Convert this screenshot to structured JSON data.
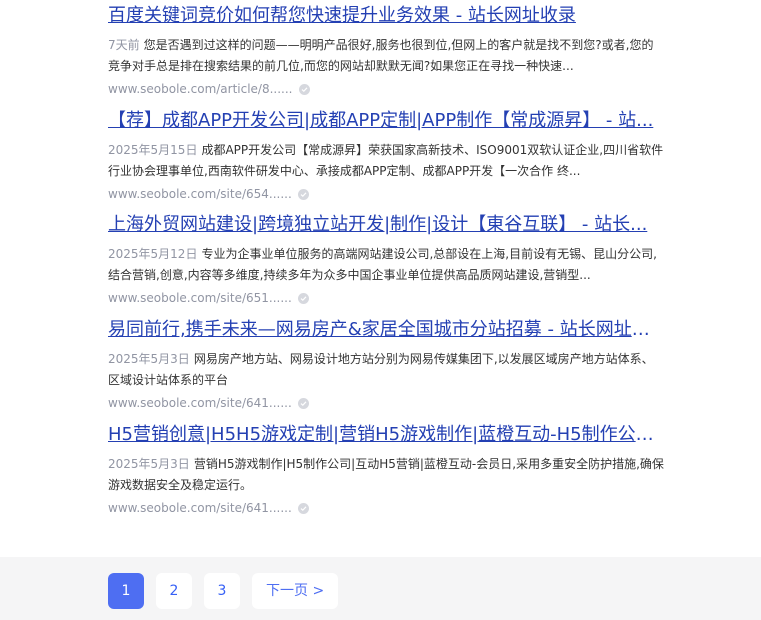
{
  "results": [
    {
      "title": "百度关键词竞价如何帮您快速提升业务效果 - 站长网址收录",
      "time": "7天前",
      "abstract": "您是否遇到过这样的问题——明明产品很好,服务也很到位,但网上的客户就是找不到您?或者,您的竞争对手总是排在搜索结果的前几位,而您的网站却默默无闻?如果您正在寻找一种快速...",
      "url": "www.seobole.com/article/8......"
    },
    {
      "title": "【荐】成都APP开发公司|成都APP定制|APP制作【常成源昇】 - 站...",
      "time": "2025年5月15日",
      "abstract": "成都APP开发公司【常成源昇】荣获国家高新技术、ISO9001双软认证企业,四川省软件行业协会理事单位,西南软件研发中心、承接成都APP定制、成都APP开发【一次合作 终...",
      "url": "www.seobole.com/site/654......"
    },
    {
      "title": "上海外贸网站建设|跨境独立站开发|制作|设计【東谷互联】 - 站长...",
      "time": "2025年5月12日",
      "abstract": "专业为企事业单位服务的高端网站建设公司,总部设在上海,目前设有无锡、昆山分公司,结合营销,创意,内容等多维度,持续多年为众多中国企事业单位提供高品质网站建设,营销型...",
      "url": "www.seobole.com/site/651......"
    },
    {
      "title": "易同前行,携手未来—网易房产&家居全国城市分站招募 - 站长网址收录",
      "time": "2025年5月3日",
      "abstract": "网易房产地方站、网易设计地方站分别为网易传媒集团下,以发展区域房产地方站体系、区域设计站体系的平台",
      "url": "www.seobole.com/site/641......"
    },
    {
      "title": "H5营销创意|H5H5游戏定制|营销H5游戏制作|蓝橙互动-H5制作公司...",
      "time": "2025年5月3日",
      "abstract": "营销H5游戏制作|H5制作公司|互动H5营销|蓝橙互动-会员日,采用多重安全防护措施,确保游戏数据安全及稳定运行。",
      "url": "www.seobole.com/site/641......"
    }
  ],
  "pagination": {
    "pages": [
      "1",
      "2",
      "3"
    ],
    "current": "1",
    "next_label": "下一页 >"
  },
  "colors": {
    "title_link": "#2440b3",
    "active_page": "#4e6ef2",
    "meta_gray": "#9195a3",
    "pager_background": "#f5f5f6"
  }
}
